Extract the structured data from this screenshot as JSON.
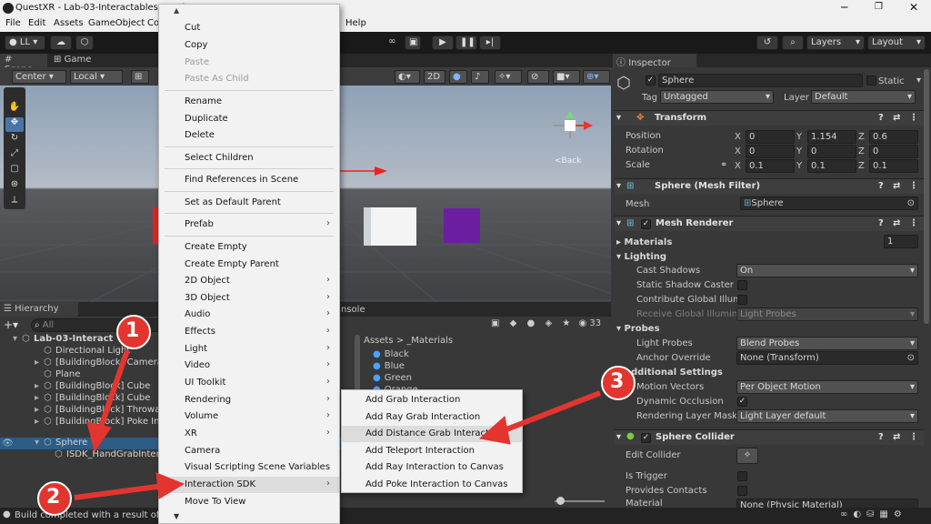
{
  "window": {
    "title": "QuestXR - Lab-03-Interactables - And"
  },
  "menubar": {
    "items": [
      "File",
      "Edit",
      "Assets",
      "GameObject",
      "Co",
      "Help"
    ]
  },
  "toolbar": {
    "account": "LL",
    "layers": "Layers",
    "layout": "Layout"
  },
  "scene": {
    "tab_scene": "Scene",
    "tab_game": "Game",
    "pivot": "Center",
    "space": "Local",
    "mode_2d": "2D",
    "back_label": "<Back"
  },
  "hierarchy": {
    "title": "Hierarchy",
    "search_placeholder": "All",
    "items": [
      "Lab-03-Interact",
      "Directional Light",
      "[BuildingBlock] Camera",
      "Plane",
      "[BuildingBlock] Cube",
      "[BuildingBlock] Cube",
      "[BuildingBlock] Throwable",
      "[BuildingBlock] Poke Int",
      "Sphere",
      "ISDK_HandGrabInteraction"
    ]
  },
  "project": {
    "tab_console": "nsole",
    "breadcrumb_assets": "Assets",
    "breadcrumb_folder": "_Materials",
    "count": "33",
    "materials": [
      "Black",
      "Blue",
      "Green",
      "Orange"
    ]
  },
  "statusbar": {
    "text": "Build completed with a result of 'S"
  },
  "context_menu": {
    "items": [
      "Cut",
      "Copy",
      "Paste",
      "Paste As Child",
      "Rename",
      "Duplicate",
      "Delete",
      "Select Children",
      "Find References in Scene",
      "Set as Default Parent",
      "Prefab",
      "Create Empty",
      "Create Empty Parent",
      "2D Object",
      "3D Object",
      "Audio",
      "Effects",
      "Light",
      "Video",
      "UI Toolkit",
      "Rendering",
      "Volume",
      "XR",
      "Camera",
      "Visual Scripting Scene Variables",
      "Interaction SDK",
      "Move To View"
    ]
  },
  "submenu": {
    "items": [
      "Add Grab Interaction",
      "Add Ray Grab Interaction",
      "Add Distance Grab Interaction",
      "Add Teleport Interaction",
      "Add Ray Interaction to Canvas",
      "Add Poke Interaction to Canvas"
    ]
  },
  "inspector": {
    "title": "Inspector",
    "object_name": "Sphere",
    "static_label": "Static",
    "tag_label": "Tag",
    "tag": "Untagged",
    "layer_label": "Layer",
    "layer": "Default",
    "transform": {
      "title": "Transform",
      "position_label": "Position",
      "rotation_label": "Rotation",
      "scale_label": "Scale",
      "position": [
        "0",
        "1.154",
        "0.6"
      ],
      "rotation": [
        "0",
        "0",
        "0"
      ],
      "scale": [
        "0.1",
        "0.1",
        "0.1"
      ],
      "axes": [
        "X",
        "Y",
        "Z"
      ]
    },
    "mesh_filter": {
      "title": "Sphere (Mesh Filter)",
      "mesh_label": "Mesh",
      "mesh": "Sphere"
    },
    "mesh_renderer": {
      "title": "Mesh Renderer",
      "materials_label": "Materials",
      "materials_count": "1",
      "lighting_label": "Lighting",
      "cast_shadows_label": "Cast Shadows",
      "cast_shadows": "On",
      "static_shadow_label": "Static Shadow Caster",
      "contribute_gi_label": "Contribute Global Illumi",
      "receive_gi_label": "Receive Global Illumina",
      "receive_gi": "Light Probes",
      "probes_label": "Probes",
      "light_probes_label": "Light Probes",
      "light_probes": "Blend Probes",
      "anchor_label": "Anchor Override",
      "anchor": "None (Transform)",
      "additional_label": "dditional Settings",
      "motion_label": "Motion Vectors",
      "motion": "Per Object Motion",
      "dyn_occ_label": "Dynamic Occlusion",
      "rlm_label": "Rendering Layer Mask",
      "rlm": "Light Layer default"
    },
    "sphere_collider": {
      "title": "Sphere Collider",
      "edit_label": "Edit Collider",
      "trigger_label": "Is Trigger",
      "contacts_label": "Provides Contacts",
      "material_label": "Material",
      "material": "None (Physic Material)"
    }
  },
  "annotations": [
    "1",
    "2",
    "3"
  ],
  "colors": {
    "accent_red": "#e53935",
    "selection": "#2c5d87",
    "highlight": "#3d87d6"
  }
}
